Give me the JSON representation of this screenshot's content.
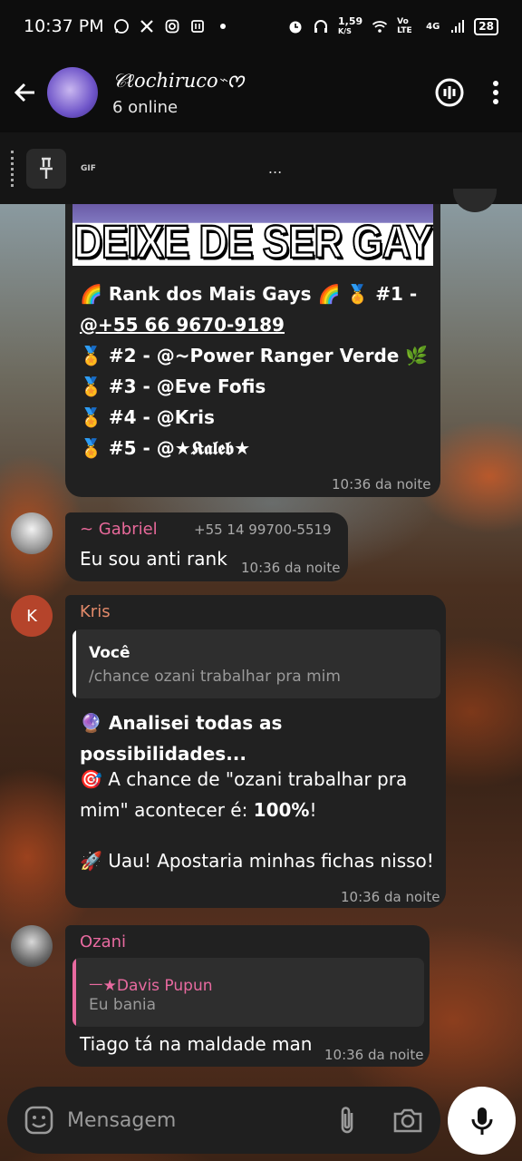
{
  "status_bar": {
    "time": "10:37 PM",
    "speed": "1,59",
    "speed_unit": "K/S",
    "network": "Vo LTE",
    "signal": "4G",
    "battery": "28"
  },
  "header": {
    "group_name": "𝒞ℓochiruco⌁ᰔ",
    "online": "6 online"
  },
  "pinned": {
    "gif_label": "GIF",
    "text": "..."
  },
  "messages": [
    {
      "meme_text": "DEIXE DE SER GAY",
      "lines": [
        "🌈 Rank dos Mais Gays 🌈 🏅 #1 -",
        "@+55 66 9670-9189",
        "🏅 #2 - @~Power Ranger Verde 🌿",
        "🏅 #3 - @Eve Fofis",
        "🏅 #4 - @Kris",
        "🏅 #5 - @★𝕶𝖆𝖑𝖊𝖇★"
      ],
      "time": "10:36 da noite"
    },
    {
      "sender": "~ Gabriel",
      "phone": "+55 14 99700-5519",
      "text": "Eu sou anti rank",
      "time": "10:36 da noite",
      "avatar_color": "#9a9a9a"
    },
    {
      "sender": "Kris",
      "avatar_letter": "K",
      "reply_author": "Você",
      "reply_text": "/chance ozani trabalhar pra mim",
      "line1": "🔮 Analisei todas as possibilidades...",
      "line2a": "🎯 A chance de \"ozani trabalhar pra",
      "line2b_prefix": "mim\" acontecer é: ",
      "line2b_bold": "100%",
      "line2b_suffix": "!",
      "line3": "🚀 Uau! Apostaria minhas fichas nisso!",
      "time": "10:36 da noite"
    },
    {
      "sender": "Ozani",
      "reply_author": "ㅡ★Davis Pupun",
      "reply_text": "Eu bania",
      "text": "Tiago tá na maldade man",
      "time": "10:36 da noite"
    }
  ],
  "input": {
    "placeholder": "Mensagem"
  },
  "colors": {
    "gabriel_name": "#e8699a",
    "kris_name": "#e38a6a",
    "ozani_name": "#e86aa0",
    "reply_bar_white": "#ffffff",
    "reply_bar_pink": "#e86aa0"
  }
}
